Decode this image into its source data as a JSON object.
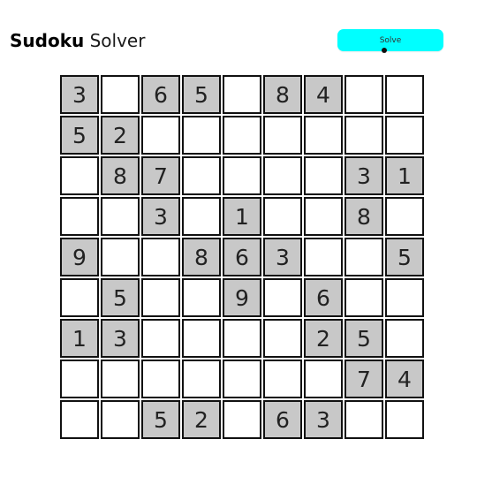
{
  "header": {
    "title_bold": "Sudoku",
    "title_rest": "Solver"
  },
  "toolbar": {
    "solve_label": "Solve"
  },
  "colors": {
    "solve_button": "#00ffff",
    "given_cell": "#c8c8c8",
    "empty_cell": "#ffffff",
    "cell_border": "#111111"
  },
  "board": {
    "rows": [
      [
        "3",
        "",
        "6",
        "5",
        "",
        "8",
        "4",
        "",
        ""
      ],
      [
        "5",
        "2",
        "",
        "",
        "",
        "",
        "",
        "",
        ""
      ],
      [
        "",
        "8",
        "7",
        "",
        "",
        "",
        "",
        "3",
        "1"
      ],
      [
        "",
        "",
        "3",
        "",
        "1",
        "",
        "",
        "8",
        ""
      ],
      [
        "9",
        "",
        "",
        "8",
        "6",
        "3",
        "",
        "",
        "5"
      ],
      [
        "",
        "5",
        "",
        "",
        "9",
        "",
        "6",
        "",
        ""
      ],
      [
        "1",
        "3",
        "",
        "",
        "",
        "",
        "2",
        "5",
        ""
      ],
      [
        "",
        "",
        "",
        "",
        "",
        "",
        "",
        "7",
        "4"
      ],
      [
        "",
        "",
        "5",
        "2",
        "",
        "6",
        "3",
        "",
        ""
      ]
    ]
  }
}
